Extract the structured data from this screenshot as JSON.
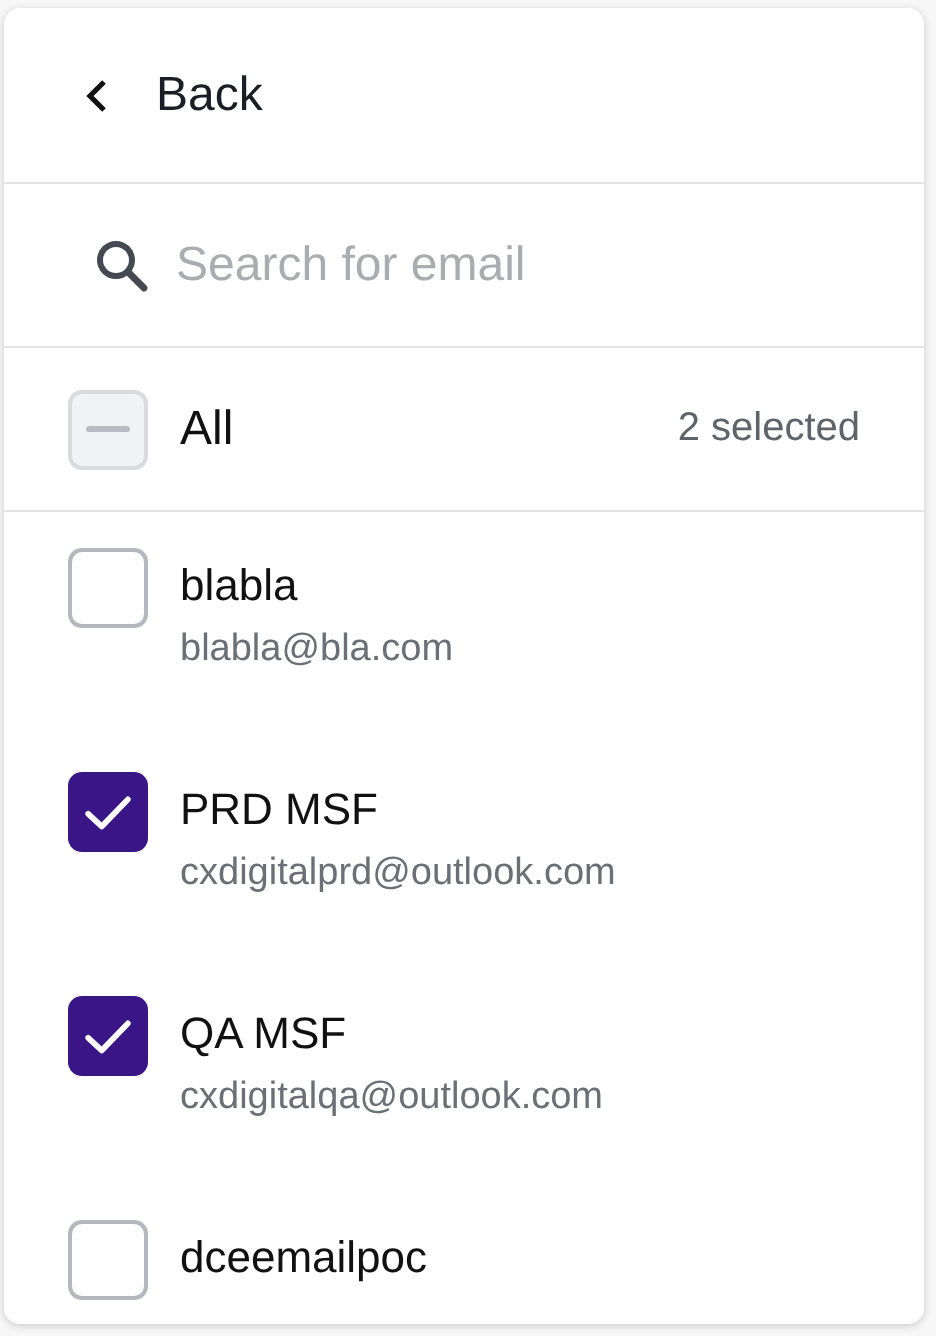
{
  "back": {
    "label": "Back"
  },
  "search": {
    "placeholder": "Search for email"
  },
  "all": {
    "label": "All",
    "checked": false,
    "indeterminate": true,
    "count": "2 selected"
  },
  "options": [
    {
      "name": "blabla",
      "email": "blabla@bla.com",
      "checked": false
    },
    {
      "name": "PRD MSF",
      "email": "cxdigitalprd@outlook.com",
      "checked": true
    },
    {
      "name": "QA MSF",
      "email": "cxdigitalqa@outlook.com",
      "checked": true
    },
    {
      "name": "dceemailpoc",
      "checked": false
    }
  ]
}
